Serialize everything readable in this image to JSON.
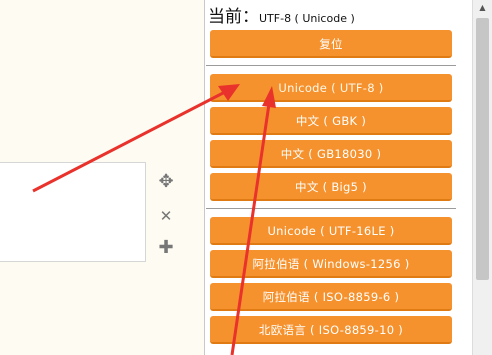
{
  "panel": {
    "current_prefix": "当前：",
    "current_value": "UTF-8 ( Unicode )",
    "reset_label": "复位",
    "group1": [
      "Unicode ( UTF-8 )",
      "中文 ( GBK )",
      "中文 ( GB18030 )",
      "中文 ( Big5 )"
    ],
    "group2": [
      "Unicode ( UTF-16LE )",
      "阿拉伯语 ( Windows-1256 )",
      "阿拉伯语 ( ISO-8859-6 )",
      "北欧语言 ( ISO-8859-10 )"
    ]
  },
  "tools": {
    "move_icon": "✥",
    "close_icon": "✕",
    "add_icon": "✚"
  },
  "colors": {
    "button": "#f6922d",
    "arrow": "#e8322b"
  }
}
